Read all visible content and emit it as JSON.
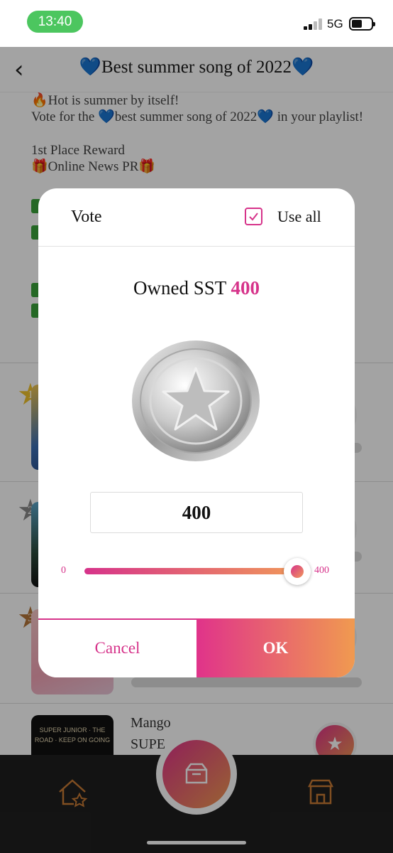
{
  "status_bar": {
    "time": "13:40",
    "network": "5G"
  },
  "header": {
    "back_glyph": "‹",
    "title": "💙Best summer song of 2022💙"
  },
  "background": {
    "desc_lines": [
      "🔥Hot is summer by itself!",
      "Vote for the 💙best summer song of 2022💙 in your playlist!",
      "1st Place Reward",
      "🎁Online News PR🎁"
    ],
    "ranking": [
      {
        "rank": "1"
      },
      {
        "rank": "2"
      },
      {
        "rank": "3"
      },
      {
        "name": "Mango",
        "artist": "SUPE",
        "album_text": "SUPER JUNIOR · THE ROAD · KEEP ON GOING"
      }
    ]
  },
  "modal": {
    "title": "Vote",
    "use_all_label": "Use all",
    "use_all_checked": true,
    "owned_label": "Owned SST",
    "owned_amount": "400",
    "coin_icon": "silver-star-coin",
    "input_value": "400",
    "slider": {
      "min": "0",
      "max": "400",
      "value_fraction": 1.0
    },
    "cancel_label": "Cancel",
    "ok_label": "OK"
  },
  "colors": {
    "accent": "#d6338a",
    "accent_end": "#f09a50",
    "status_green": "#4cc65f"
  },
  "bottom_nav": {
    "items": [
      "home-star-icon",
      "vote-box-icon",
      "shop-icon"
    ]
  }
}
